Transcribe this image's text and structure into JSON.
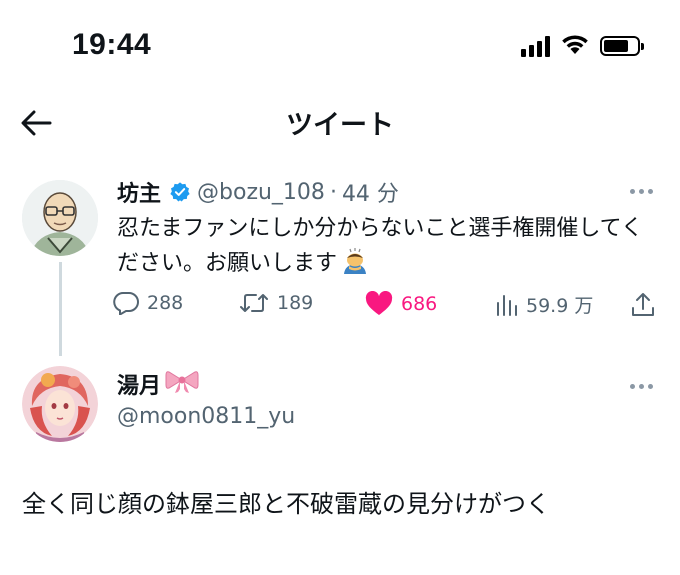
{
  "status_bar": {
    "time": "19:44",
    "icons": [
      "cellular-signal-icon",
      "wifi-icon",
      "battery-icon"
    ],
    "battery_level": 0.75
  },
  "nav": {
    "back_icon": "arrow-left-icon",
    "title": "ツイート"
  },
  "tweet": {
    "name": "坊主",
    "verified_icon": "verified-badge-icon",
    "handle": "@bozu_108",
    "separator": "·",
    "time": "44 分",
    "text": "忍たまファンにしか分からないこと選手権開催してください。お願いします",
    "emoji": "bowing-person-emoji",
    "actions": {
      "replies": "288",
      "retweets": "189",
      "likes": "686",
      "views": "59.9 万"
    },
    "liked": true,
    "colors": {
      "like": "#f91880",
      "verified": "#1d9bf0",
      "secondary": "#536471"
    }
  },
  "reply": {
    "name": "湯月",
    "name_decoration": "ribbon-emoji",
    "handle": "@moon0811_yu",
    "text": "全く同じ顔の鉢屋三郎と不破雷蔵の見分けがつく"
  }
}
